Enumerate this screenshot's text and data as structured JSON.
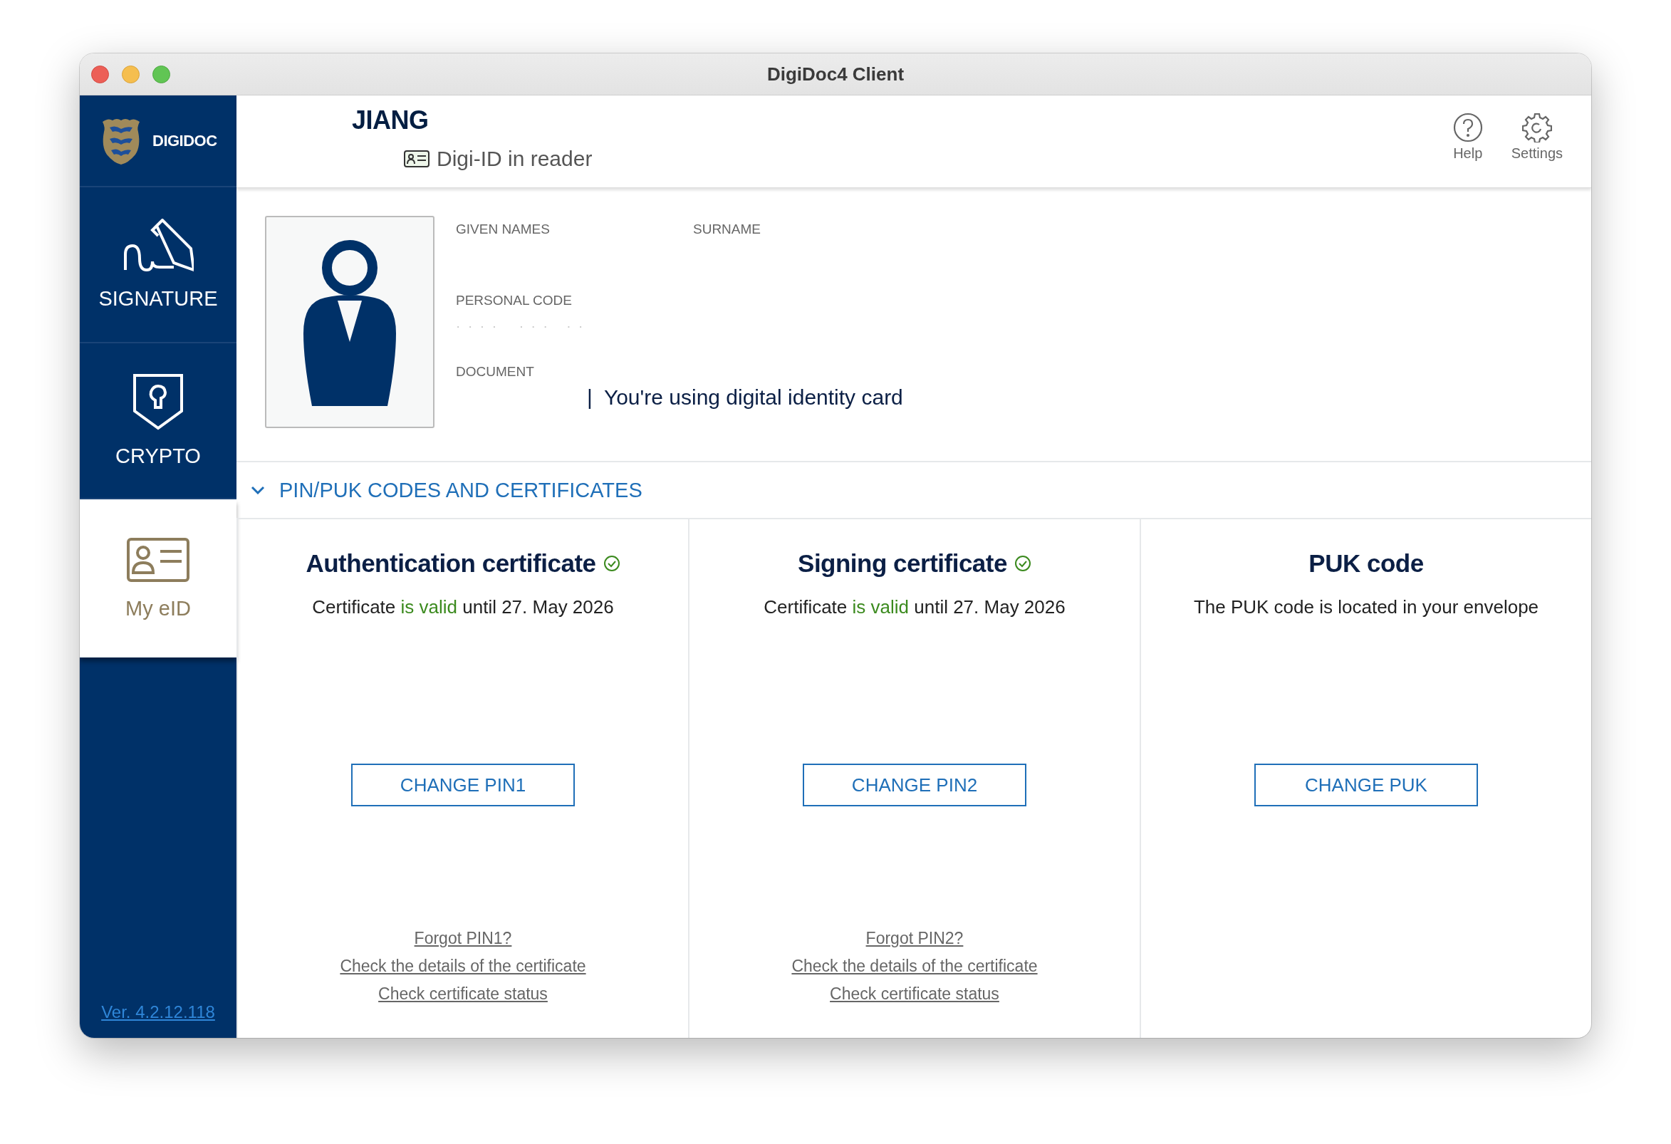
{
  "window": {
    "title": "DigiDoc4 Client"
  },
  "sidebar": {
    "logo_text": "DIGIDOC",
    "items": [
      {
        "kind": "signature",
        "label": "SIGNATURE",
        "selected": false
      },
      {
        "kind": "crypto",
        "label": "CRYPTO",
        "selected": false
      },
      {
        "kind": "eid",
        "label": "My eID",
        "selected": true
      }
    ],
    "version": "Ver. 4.2.12.118"
  },
  "header": {
    "name": "JIANG",
    "card_status": "Digi-ID in reader",
    "actions": [
      {
        "kind": "help",
        "label": "Help"
      },
      {
        "kind": "settings",
        "label": "Settings"
      }
    ]
  },
  "person": {
    "fields": [
      {
        "label": "GIVEN NAMES"
      },
      {
        "label": "SURNAME"
      },
      {
        "label": "PERSONAL CODE",
        "value": "·  ·  ·  ·      ·  ·  ·     ·  ·"
      },
      {
        "label": "DOCUMENT",
        "value": "|  You're using digital identity card"
      }
    ]
  },
  "section": {
    "title": "PIN/PUK CODES AND CERTIFICATES",
    "expanded": true
  },
  "cards": [
    {
      "title": "Authentication certificate",
      "verified": true,
      "status": [
        {
          "kind": "plain",
          "text": "Certificate "
        },
        {
          "kind": "valid",
          "text": "is valid"
        },
        {
          "kind": "plain",
          "text": " until 27. May 2026"
        }
      ],
      "button": "CHANGE PIN1",
      "links": [
        "Forgot PIN1?",
        "Check the details of the certificate",
        "Check certificate status"
      ]
    },
    {
      "title": "Signing certificate",
      "verified": true,
      "status": [
        {
          "kind": "plain",
          "text": "Certificate "
        },
        {
          "kind": "valid",
          "text": "is valid"
        },
        {
          "kind": "plain",
          "text": " until 27. May 2026"
        }
      ],
      "button": "CHANGE PIN2",
      "links": [
        "Forgot PIN2?",
        "Check the details of the certificate",
        "Check certificate status"
      ]
    },
    {
      "title": "PUK code",
      "verified": false,
      "status": [
        {
          "kind": "plain",
          "text": "The PUK code is located in your envelope"
        }
      ],
      "button": "CHANGE PUK"
    }
  ]
}
